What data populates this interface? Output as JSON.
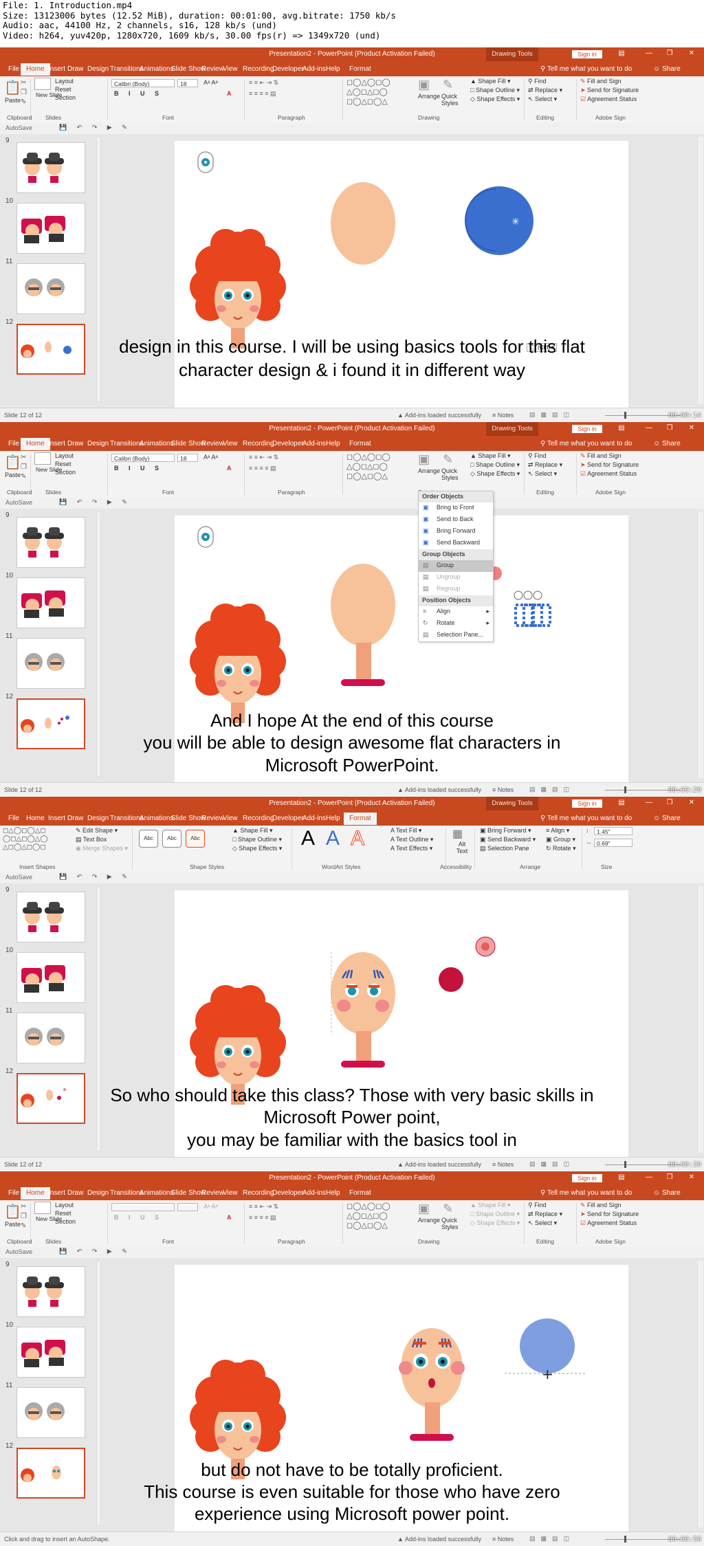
{
  "meta_lines": [
    "File: 1. Introduction.mp4",
    "Size: 13123006 bytes (12.52 MiB), duration: 00:01:00, avg.bitrate: 1750 kb/s",
    "Audio: aac, 44100 Hz, 2 channels, s16, 128 kb/s (und)",
    "Video: h264, yuv420p, 1280x720, 1609 kb/s, 30.00 fps(r) => 1349x720 (und)"
  ],
  "window_title": "Presentation2  -  PowerPoint (Product Activation Failed)",
  "drawing_tools": "Drawing Tools",
  "sign_in": "Sign in",
  "tabs": [
    "File",
    "Home",
    "Insert",
    "Draw",
    "Design",
    "Transitions",
    "Animations",
    "Slide Show",
    "Review",
    "View",
    "Recording",
    "Developer",
    "Add-ins",
    "Help",
    "Format"
  ],
  "tell_me": "Tell me what you want to do",
  "share": "Share",
  "home": {
    "paste": "Paste",
    "new_slide": "New Slide",
    "layout": "Layout",
    "reset": "Reset",
    "section": "Section",
    "font_name": "Calibri (Body)",
    "font_size": "18",
    "arrange": "Arrange",
    "quick_styles": "Quick Styles",
    "shape_fill": "Shape Fill",
    "shape_outline": "Shape Outline",
    "shape_effects": "Shape Effects",
    "find": "Find",
    "replace": "Replace",
    "select": "Select",
    "fill_sign": "Fill and Sign",
    "send_sig": "Send for Signature",
    "agree": "Agreement Status",
    "groups": [
      "Clipboard",
      "Slides",
      "Font",
      "Paragraph",
      "Drawing",
      "Editing",
      "Adobe Sign"
    ]
  },
  "format": {
    "edit_shape": "Edit Shape",
    "text_box": "Text Box",
    "merge_shapes": "Merge Shapes",
    "abc": "Abc",
    "shape_fill": "Shape Fill",
    "shape_outline": "Shape Outline",
    "shape_effects": "Shape Effects",
    "wordart": "A",
    "text_fill": "Text Fill",
    "text_outline": "Text Outline",
    "text_effects": "Text Effects",
    "alt_text": "Alt Text",
    "bring_forward": "Bring Forward",
    "send_backward": "Send Backward",
    "selection_pane": "Selection Pane",
    "align": "Align",
    "group": "Group",
    "rotate": "Rotate",
    "height": "1.45\"",
    "width": "0.69\"",
    "groups": [
      "Insert Shapes",
      "Shape Styles",
      "WordArt Styles",
      "Accessibility",
      "Arrange",
      "Size"
    ]
  },
  "autosave": "AutoSave",
  "slide_numbers": [
    "9",
    "10",
    "11",
    "12"
  ],
  "status_slide": "Slide 12 of 12",
  "status_addins": "Add-ins loaded successfully",
  "status_notes": "Notes",
  "status_hint": "Click and drag to insert an AutoShape.",
  "paste_tag": "(Ctrl)",
  "arrange_menu": {
    "order_header": "Order Objects",
    "order_items": [
      "Bring to Front",
      "Send to Back",
      "Bring Forward",
      "Send Backward"
    ],
    "group_header": "Group Objects",
    "group_items": [
      "Group",
      "Ungroup",
      "Regroup"
    ],
    "position_header": "Position Objects",
    "position_items": [
      "Align",
      "Rotate",
      "Selection Pane..."
    ]
  },
  "timestamps": [
    "00:00:14",
    "00:00:29",
    "00:00:39",
    "00:00:50"
  ],
  "subtitles": [
    [
      "design in this course. I will be using basics tools for this flat",
      "character design & i found it in different way"
    ],
    [
      "And I hope At the end of this course",
      "you will be able to design awesome flat characters in",
      "Microsoft PowerPoint."
    ],
    [
      "So who should take this class? Those with very basic skills in",
      "Microsoft Power point,",
      "you may be familiar with the basics tool in"
    ],
    [
      "but do not have to be totally proficient.",
      "This course is even suitable for those who have zero",
      "experience using Microsoft power point."
    ]
  ],
  "colors": {
    "ribbon": "#c8481f",
    "hair": "#e8441e",
    "skin": "#f7c29a",
    "blue": "#3a6fd0",
    "lightblue": "#7f9ee0",
    "red": "#d0104a"
  }
}
